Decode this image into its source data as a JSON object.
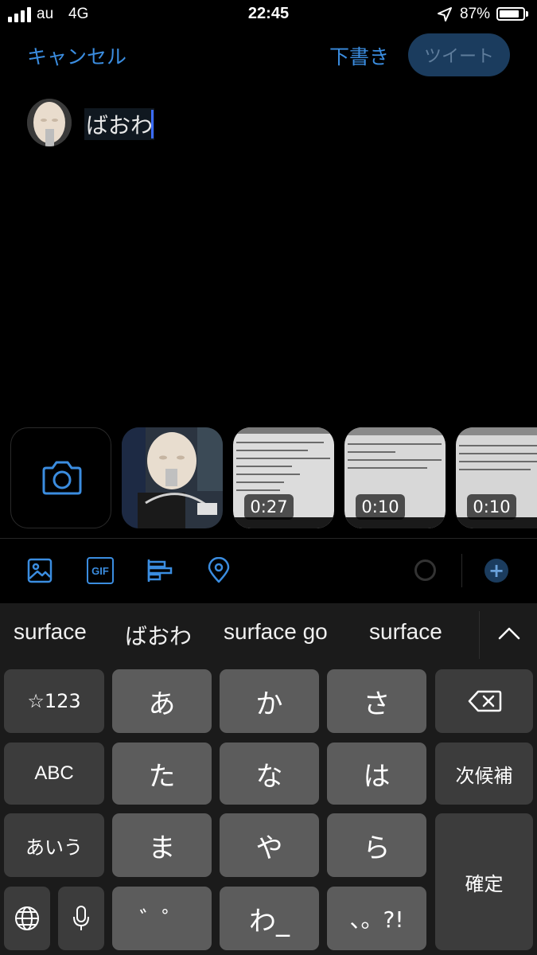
{
  "status_bar": {
    "carrier": "au",
    "network": "4G",
    "time": "22:45",
    "battery_percent": "87%",
    "battery_level": 0.87
  },
  "header": {
    "cancel_label": "キャンセル",
    "draft_label": "下書き",
    "tweet_label": "ツイート"
  },
  "composer": {
    "text": "ばおわ"
  },
  "media": {
    "videos": [
      {
        "duration": "0:27"
      },
      {
        "duration": "0:10"
      },
      {
        "duration": "0:10"
      }
    ]
  },
  "toolbar": {
    "icons": [
      "image-icon",
      "gif-icon",
      "poll-icon",
      "location-icon"
    ],
    "gif_label": "GIF",
    "add_label": "+"
  },
  "keyboard": {
    "suggestions": [
      "surface",
      "ばおわ",
      "surface go",
      "surface"
    ],
    "keys": {
      "mode_num": "☆123",
      "a": "あ",
      "ka": "か",
      "sa": "さ",
      "abc": "ABC",
      "ta": "た",
      "na": "な",
      "ha": "は",
      "next_candidate": "次候補",
      "aiu": "あいう",
      "ma": "ま",
      "ya": "や",
      "ra": "ら",
      "confirm": "確定",
      "dakuten": "゛゜",
      "wa": "わ_",
      "punct": "、。?!"
    }
  },
  "colors": {
    "accent": "#3b8de0",
    "tweet_button_bg": "#1b3c5e",
    "keyboard_bg": "#1b1b1b"
  }
}
